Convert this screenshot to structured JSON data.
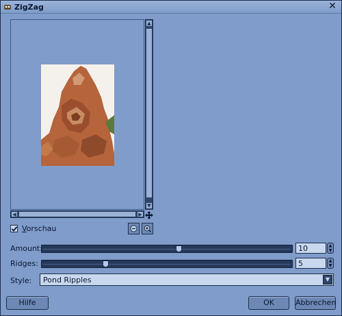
{
  "window": {
    "title": "ZigZag",
    "close_glyph": "✕",
    "app_icon": "gimp-icon",
    "close_icon": "close-icon"
  },
  "preview": {
    "image_icon": "sculpture-preview-image",
    "scroll_up_glyph": "▲",
    "scroll_down_glyph": "▼",
    "scroll_left_glyph": "◀",
    "scroll_right_glyph": "▶",
    "navigate_icon": "move-arrows-icon"
  },
  "preview_toggle": {
    "label": "Vorschau",
    "checked": true
  },
  "zoom": {
    "out_icon": "zoom-out-icon",
    "in_icon": "zoom-in-icon"
  },
  "params": {
    "amount": {
      "label": "Amount:",
      "value": "10",
      "level": 0.55
    },
    "ridges": {
      "label": "Ridges:",
      "value": "5",
      "level": 0.25
    },
    "style": {
      "label": "Style:",
      "value": "Pond Ripples"
    }
  },
  "buttons": {
    "help": "Hilfe",
    "ok": "OK",
    "cancel": "Abbrechen"
  },
  "colors": {
    "background": "#7f9cca",
    "trough": "#26395a",
    "entry": "#c9d8ee"
  }
}
